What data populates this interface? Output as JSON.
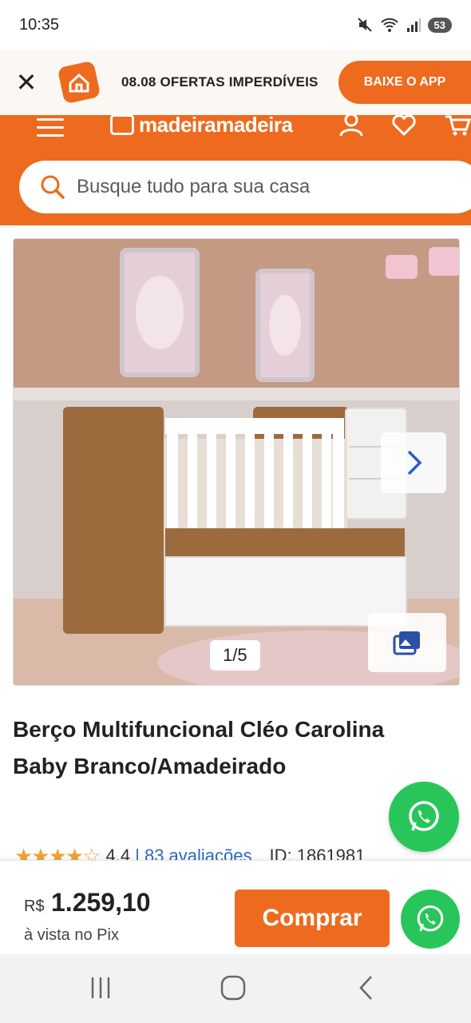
{
  "status_bar": {
    "time": "10:35",
    "battery": "53"
  },
  "app_banner": {
    "close_icon": "close-icon",
    "text": "08.08 OFERTAS IMPERDÍVEIS",
    "button_label": "BAIXE O APP"
  },
  "header": {
    "logo_text": "madeiramadeira",
    "search_placeholder": "Busque tudo para sua casa",
    "brand_color": "#ee6a1e"
  },
  "gallery": {
    "counter": "1/5",
    "next_icon": "chevron-right-icon",
    "photos_icon": "photo-gallery-icon"
  },
  "product": {
    "title": "Berço Multifuncional Cléo Carolina Baby Branco/Amadeirado",
    "rating": "4,4",
    "rating_value": 4.4,
    "reviews": "| 83 avaliações",
    "id": "ID: 1861981"
  },
  "buy_bar": {
    "currency": "R$",
    "price": "1.259,10",
    "price_note": "à vista no Pix",
    "buy_label": "Comprar"
  },
  "colors": {
    "accent": "#ee6a1e",
    "whatsapp": "#28c65a",
    "link": "#2a6cc4"
  }
}
